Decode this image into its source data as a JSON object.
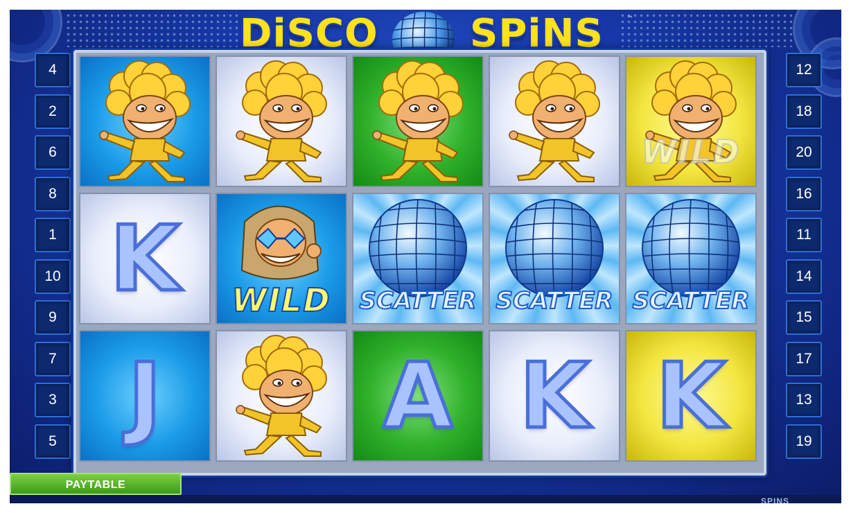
{
  "game": {
    "title_left": "DiSCO",
    "title_right": "SPiNS",
    "trademark": "™"
  },
  "paylines": {
    "left": [
      "4",
      "2",
      "6",
      "8",
      "1",
      "10",
      "9",
      "7",
      "3",
      "5"
    ],
    "right": [
      "12",
      "18",
      "20",
      "16",
      "11",
      "14",
      "15",
      "17",
      "13",
      "19"
    ]
  },
  "reels": [
    [
      "disco-guy",
      "k",
      "j"
    ],
    [
      "disco-guy",
      "wild",
      "disco-guy"
    ],
    [
      "disco-guy",
      "scatter",
      "a"
    ],
    [
      "disco-guy",
      "scatter",
      "k"
    ],
    [
      "disco-guy-wild-faded",
      "scatter",
      "k"
    ]
  ],
  "cell_backgrounds": [
    [
      "blue",
      "white",
      "blue"
    ],
    [
      "white",
      "blue",
      "white"
    ],
    [
      "green",
      "rays",
      "green"
    ],
    [
      "white",
      "rays",
      "white"
    ],
    [
      "yellow",
      "rays",
      "yellow"
    ]
  ],
  "symbol_text": {
    "k": "K",
    "j": "J",
    "a": "A",
    "wild": "WILD",
    "scatter": "SCATTER"
  },
  "buttons": {
    "paytable": "PAYTABLE"
  },
  "footer": {
    "spins_label": "SPINS"
  },
  "colors": {
    "frame_blue": "#1638a8",
    "title_yellow": "#ffe21a",
    "paytable_green": "#3a9b1a"
  }
}
